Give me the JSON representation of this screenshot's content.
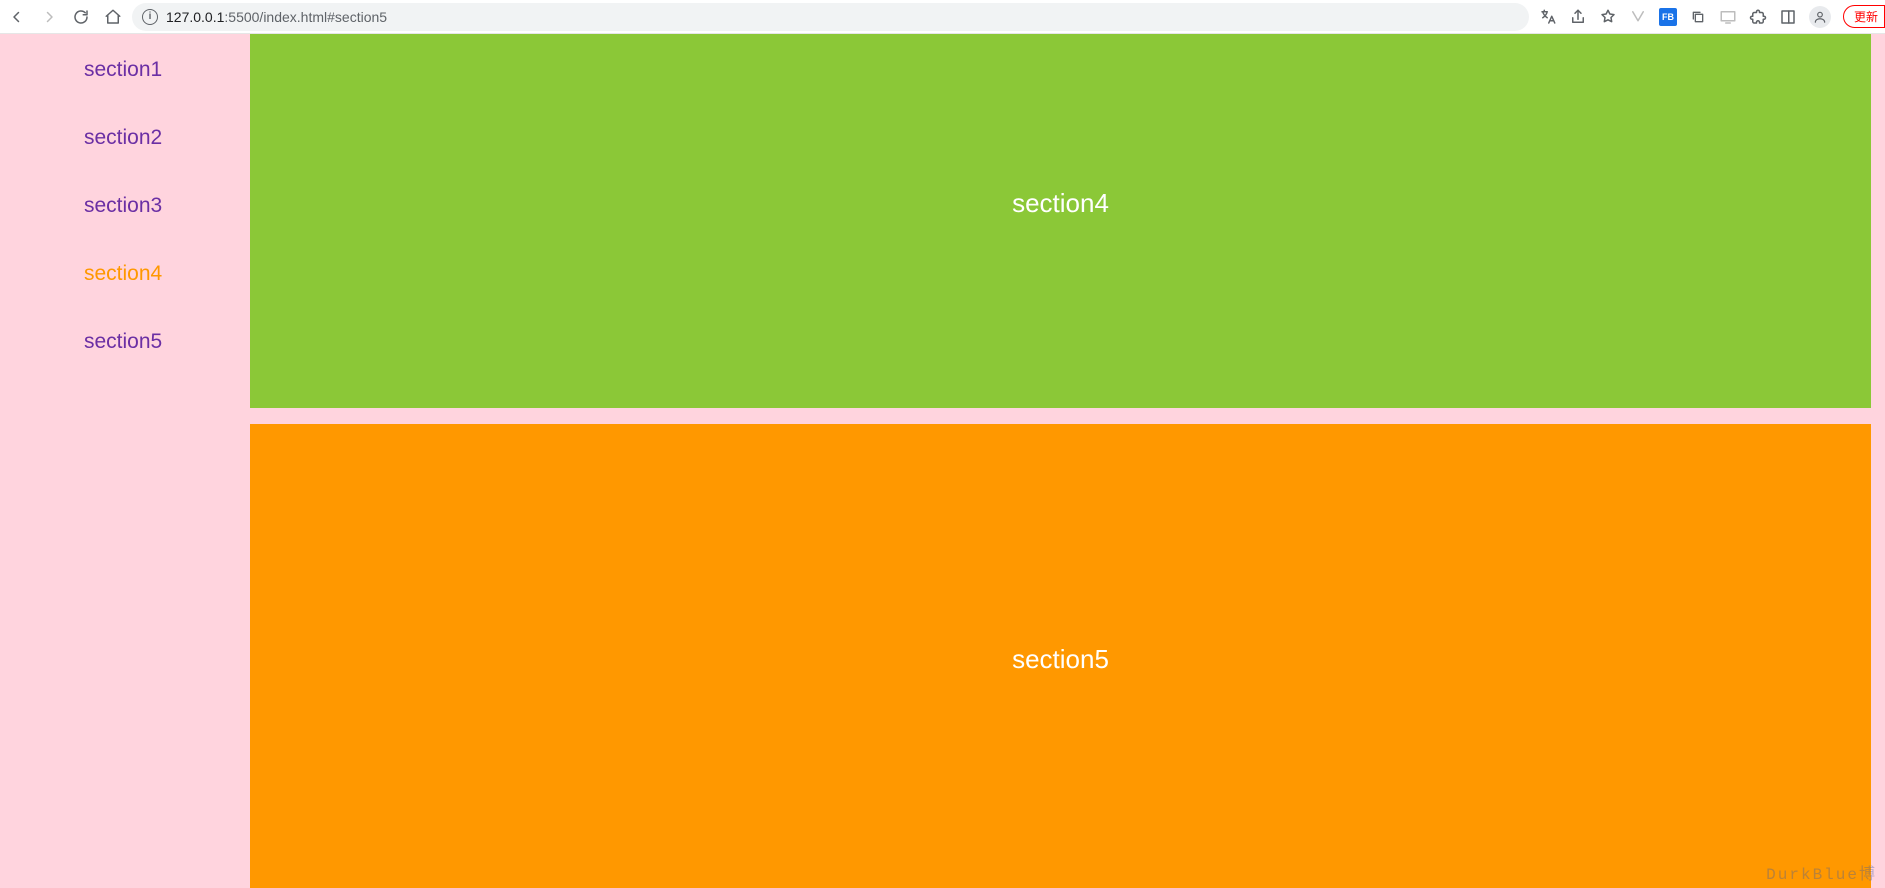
{
  "browser": {
    "url_host": "127.0.0.1",
    "url_port_path": ":5500/index.html#section5",
    "update_label": "更新"
  },
  "sidebar": {
    "items": [
      {
        "label": "section1",
        "active": false
      },
      {
        "label": "section2",
        "active": false
      },
      {
        "label": "section3",
        "active": false
      },
      {
        "label": "section4",
        "active": true
      },
      {
        "label": "section5",
        "active": false
      }
    ]
  },
  "panels": {
    "sec4_label": "section4",
    "sec5_label": "section5"
  },
  "watermark": "DurkBlue博"
}
